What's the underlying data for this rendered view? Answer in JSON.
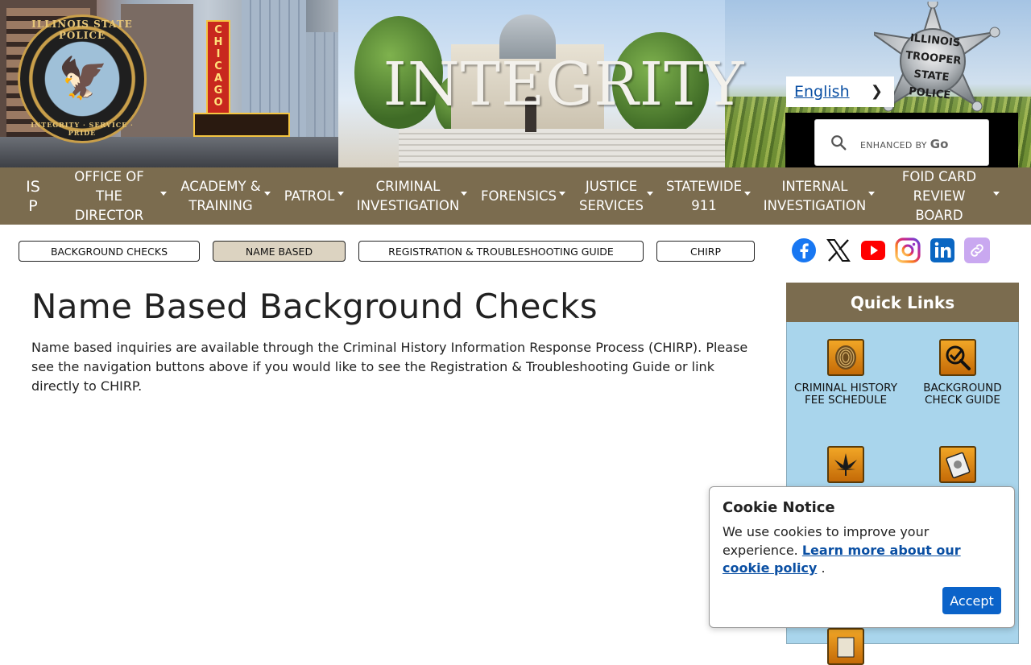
{
  "banner": {
    "title": "INTEGRITY",
    "seal_text_top": "ILLINOIS STATE POLICE",
    "seal_text_bottom": "INTEGRITY · SERVICE · PRIDE",
    "chicago_sign": "CHICAGO",
    "badge_text": "ILLINOIS TROOPER STATE POLICE",
    "seal_icon": "eagle-seal-icon",
    "badge_icon": "trooper-star-badge-icon"
  },
  "translate": {
    "language_label": "English",
    "chevron_icon": "chevron-right-icon"
  },
  "search": {
    "placeholder": "",
    "enhanced_label": "ENHANCED BY",
    "enhanced_brand": "Go",
    "icon": "search-icon"
  },
  "main_nav": {
    "items": [
      {
        "label": "IS\nP",
        "has_dropdown": false
      },
      {
        "label": "OFFICE OF\nTHE\nDIRECTOR",
        "has_dropdown": true
      },
      {
        "label": "ACADEMY &\nTRAINING",
        "has_dropdown": true
      },
      {
        "label": "PATROL",
        "has_dropdown": true
      },
      {
        "label": "CRIMINAL\nINVESTIGATION",
        "has_dropdown": true
      },
      {
        "label": "FORENSICS",
        "has_dropdown": true
      },
      {
        "label": "JUSTICE\nSERVICES",
        "has_dropdown": true
      },
      {
        "label": "STATEWIDE\n911",
        "has_dropdown": true
      },
      {
        "label": "INTERNAL\nINVESTIGATION",
        "has_dropdown": true
      },
      {
        "label": "FOID CARD\nREVIEW\nBOARD",
        "has_dropdown": true
      }
    ]
  },
  "sub_nav": {
    "buttons": [
      {
        "label": "BACKGROUND CHECKS",
        "active": false
      },
      {
        "label": "NAME BASED",
        "active": true
      },
      {
        "label": "REGISTRATION & TROUBLESHOOTING GUIDE",
        "active": false
      },
      {
        "label": "CHIRP",
        "active": false
      }
    ]
  },
  "social": {
    "icons": [
      "facebook-icon",
      "x-icon",
      "youtube-icon",
      "instagram-icon",
      "linkedin-icon",
      "link-icon"
    ],
    "colors": {
      "facebook": "#1877f2",
      "youtube": "#ff0000",
      "linkedin": "#0a66c2",
      "link": "#c9a8f0"
    }
  },
  "content": {
    "title": "Name Based Background Checks",
    "body": "Name based inquiries are available through the Criminal History Information Response Process (CHIRP). Please see the navigation buttons above if you would like to see the Registration & Troubleshooting Guide or link directly to CHIRP."
  },
  "quick_links": {
    "heading": "Quick Links",
    "items": [
      {
        "label": "CRIMINAL HISTORY FEE SCHEDULE",
        "icon": "fingerprint-icon"
      },
      {
        "label": "BACKGROUND CHECK GUIDE",
        "icon": "magnifier-check-icon"
      },
      {
        "label": "",
        "icon": "cannabis-leaf-icon"
      },
      {
        "label": "",
        "icon": "handbook-icon"
      },
      {
        "label": "",
        "icon": "sheriff-document-icon"
      }
    ]
  },
  "cookie": {
    "title": "Cookie Notice",
    "body_prefix": "We use cookies to improve your experience.",
    "link_text": "Learn more about our cookie policy",
    "body_suffix": ".",
    "accept_label": "Accept"
  },
  "colors": {
    "nav_bg": "#7b6c4f",
    "active_subnav_bg": "#dcd3c1",
    "quicklinks_bg": "#a9d5ec",
    "accept_bg": "#0b63c9",
    "link": "#0a4fa3"
  }
}
